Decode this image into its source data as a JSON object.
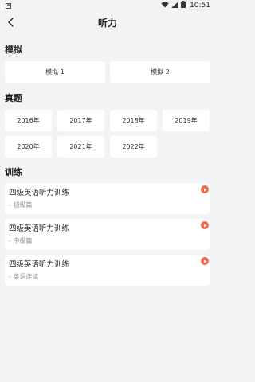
{
  "status_bar": {
    "time": "10:51",
    "left_glyph": "A"
  },
  "header": {
    "title": "听力"
  },
  "mock": {
    "title": "模拟",
    "items": [
      "模拟 1",
      "模拟 2"
    ]
  },
  "real": {
    "title": "真题",
    "years": [
      "2016年",
      "2017年",
      "2018年",
      "2019年",
      "2020年",
      "2021年",
      "2022年"
    ]
  },
  "training": {
    "title": "训练",
    "items": [
      {
        "title": "四级英语听力训练",
        "subtitle": "- 初级篇"
      },
      {
        "title": "四级英语听力训练",
        "subtitle": "- 中级篇"
      },
      {
        "title": "四级英语听力训练",
        "subtitle": "- 英语连读"
      }
    ]
  },
  "colors": {
    "background": "#f2f3f5",
    "card": "#ffffff",
    "play_accent": "#f16a4d"
  }
}
